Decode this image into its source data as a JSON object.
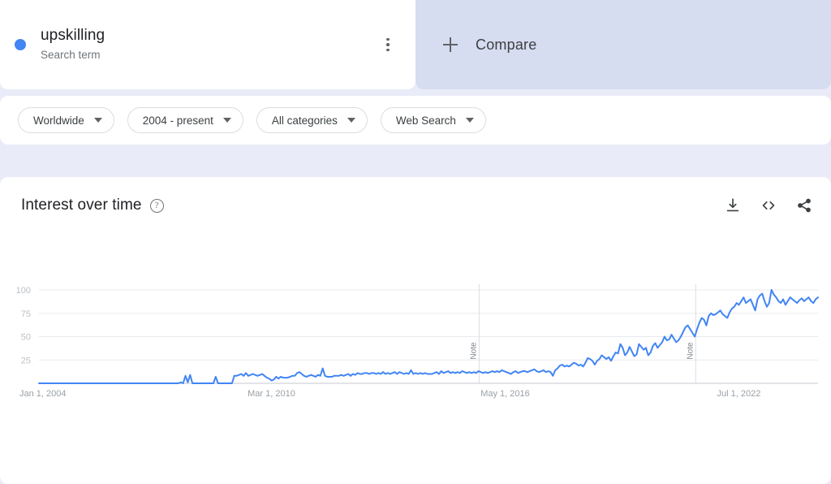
{
  "term": {
    "name": "upskilling",
    "subtitle": "Search term",
    "dot_color": "#4285f4",
    "menu_icon": "more-vert-icon"
  },
  "compare": {
    "label": "Compare",
    "icon": "plus-icon"
  },
  "filters": [
    {
      "label": "Worldwide",
      "name": "location"
    },
    {
      "label": "2004 - present",
      "name": "time-range"
    },
    {
      "label": "All categories",
      "name": "category"
    },
    {
      "label": "Web Search",
      "name": "search-type"
    }
  ],
  "chart_panel": {
    "title": "Interest over time",
    "help_icon": "help-circle-icon",
    "actions": [
      {
        "name": "download-icon",
        "label": "Download"
      },
      {
        "name": "embed-code-icon",
        "label": "Embed"
      },
      {
        "name": "share-icon",
        "label": "Share"
      }
    ]
  },
  "chart_data": {
    "type": "line",
    "title": "Interest over time",
    "xlabel": "",
    "ylabel": "",
    "ylim": [
      0,
      100
    ],
    "yticks": [
      25,
      50,
      75,
      100
    ],
    "ytick_labels": [
      "25",
      "50",
      "75",
      "100"
    ],
    "grid": true,
    "legend": false,
    "line_color": "#4285f4",
    "x_start": "2004-01-01",
    "x_end": "2024-09-01",
    "xtick_labels": [
      "Jan 1, 2004",
      "Mar 1, 2010",
      "May 1, 2016",
      "Jul 1, 2022"
    ],
    "xtick_positions": [
      0,
      0.2984,
      0.5984,
      0.8984
    ],
    "annotations": [
      {
        "label": "Note",
        "position": 0.565
      },
      {
        "label": "Note",
        "position": 0.843
      }
    ],
    "series": [
      {
        "name": "upskilling",
        "values": [
          0,
          0,
          0,
          0,
          0,
          0,
          0,
          0,
          0,
          0,
          0,
          0,
          0,
          0,
          0,
          0,
          0,
          0,
          0,
          0,
          0,
          0,
          0,
          0,
          0,
          0,
          0,
          0,
          0,
          0,
          0,
          0,
          0,
          0,
          0,
          0,
          0,
          0,
          0,
          0,
          0,
          0,
          0,
          0,
          0,
          0,
          0,
          0,
          0,
          0,
          0,
          0,
          0,
          0,
          0,
          0,
          0,
          0,
          0,
          0,
          0,
          1,
          0,
          8,
          1,
          9,
          0,
          0,
          0,
          0,
          0,
          0,
          0,
          0,
          0,
          0,
          7,
          0,
          0,
          0,
          0,
          0,
          0,
          0,
          8,
          8,
          9,
          10,
          8,
          11,
          8,
          9,
          10,
          9,
          8,
          9,
          10,
          8,
          6,
          5,
          3,
          4,
          7,
          5,
          7,
          6,
          6,
          6,
          7,
          8,
          8,
          11,
          12,
          10,
          8,
          7,
          8,
          9,
          8,
          7,
          9,
          8,
          16,
          8,
          7,
          7,
          7,
          8,
          8,
          8,
          9,
          8,
          9,
          10,
          8,
          10,
          9,
          11,
          10,
          10,
          11,
          11,
          10,
          11,
          11,
          10,
          11,
          10,
          12,
          10,
          11,
          10,
          11,
          12,
          10,
          12,
          11,
          10,
          11,
          10,
          14,
          10,
          11,
          10,
          11,
          10,
          11,
          10,
          10,
          10,
          11,
          12,
          10,
          13,
          11,
          12,
          13,
          11,
          12,
          11,
          12,
          11,
          13,
          12,
          11,
          12,
          11,
          12,
          11,
          13,
          12,
          11,
          12,
          11,
          12,
          13,
          12,
          13,
          12,
          14,
          13,
          12,
          11,
          10,
          12,
          13,
          11,
          12,
          13,
          13,
          12,
          13,
          14,
          15,
          13,
          12,
          13,
          14,
          12,
          13,
          12,
          8,
          14,
          16,
          19,
          20,
          18,
          19,
          18,
          20,
          22,
          21,
          19,
          20,
          18,
          22,
          27,
          26,
          24,
          20,
          24,
          26,
          30,
          28,
          26,
          28,
          24,
          29,
          33,
          32,
          42,
          38,
          30,
          33,
          39,
          34,
          29,
          31,
          42,
          39,
          36,
          38,
          30,
          33,
          40,
          43,
          38,
          41,
          44,
          50,
          46,
          47,
          52,
          48,
          44,
          46,
          50,
          55,
          60,
          62,
          58,
          54,
          50,
          58,
          65,
          70,
          68,
          62,
          72,
          75,
          73,
          74,
          76,
          78,
          74,
          72,
          70,
          76,
          80,
          82,
          86,
          84,
          88,
          92,
          86,
          88,
          90,
          84,
          78,
          90,
          94,
          96,
          88,
          82,
          86,
          100,
          95,
          92,
          88,
          86,
          90,
          84,
          88,
          92,
          90,
          88,
          86,
          89,
          91,
          88,
          90,
          92,
          88,
          86,
          90,
          92
        ]
      }
    ]
  }
}
